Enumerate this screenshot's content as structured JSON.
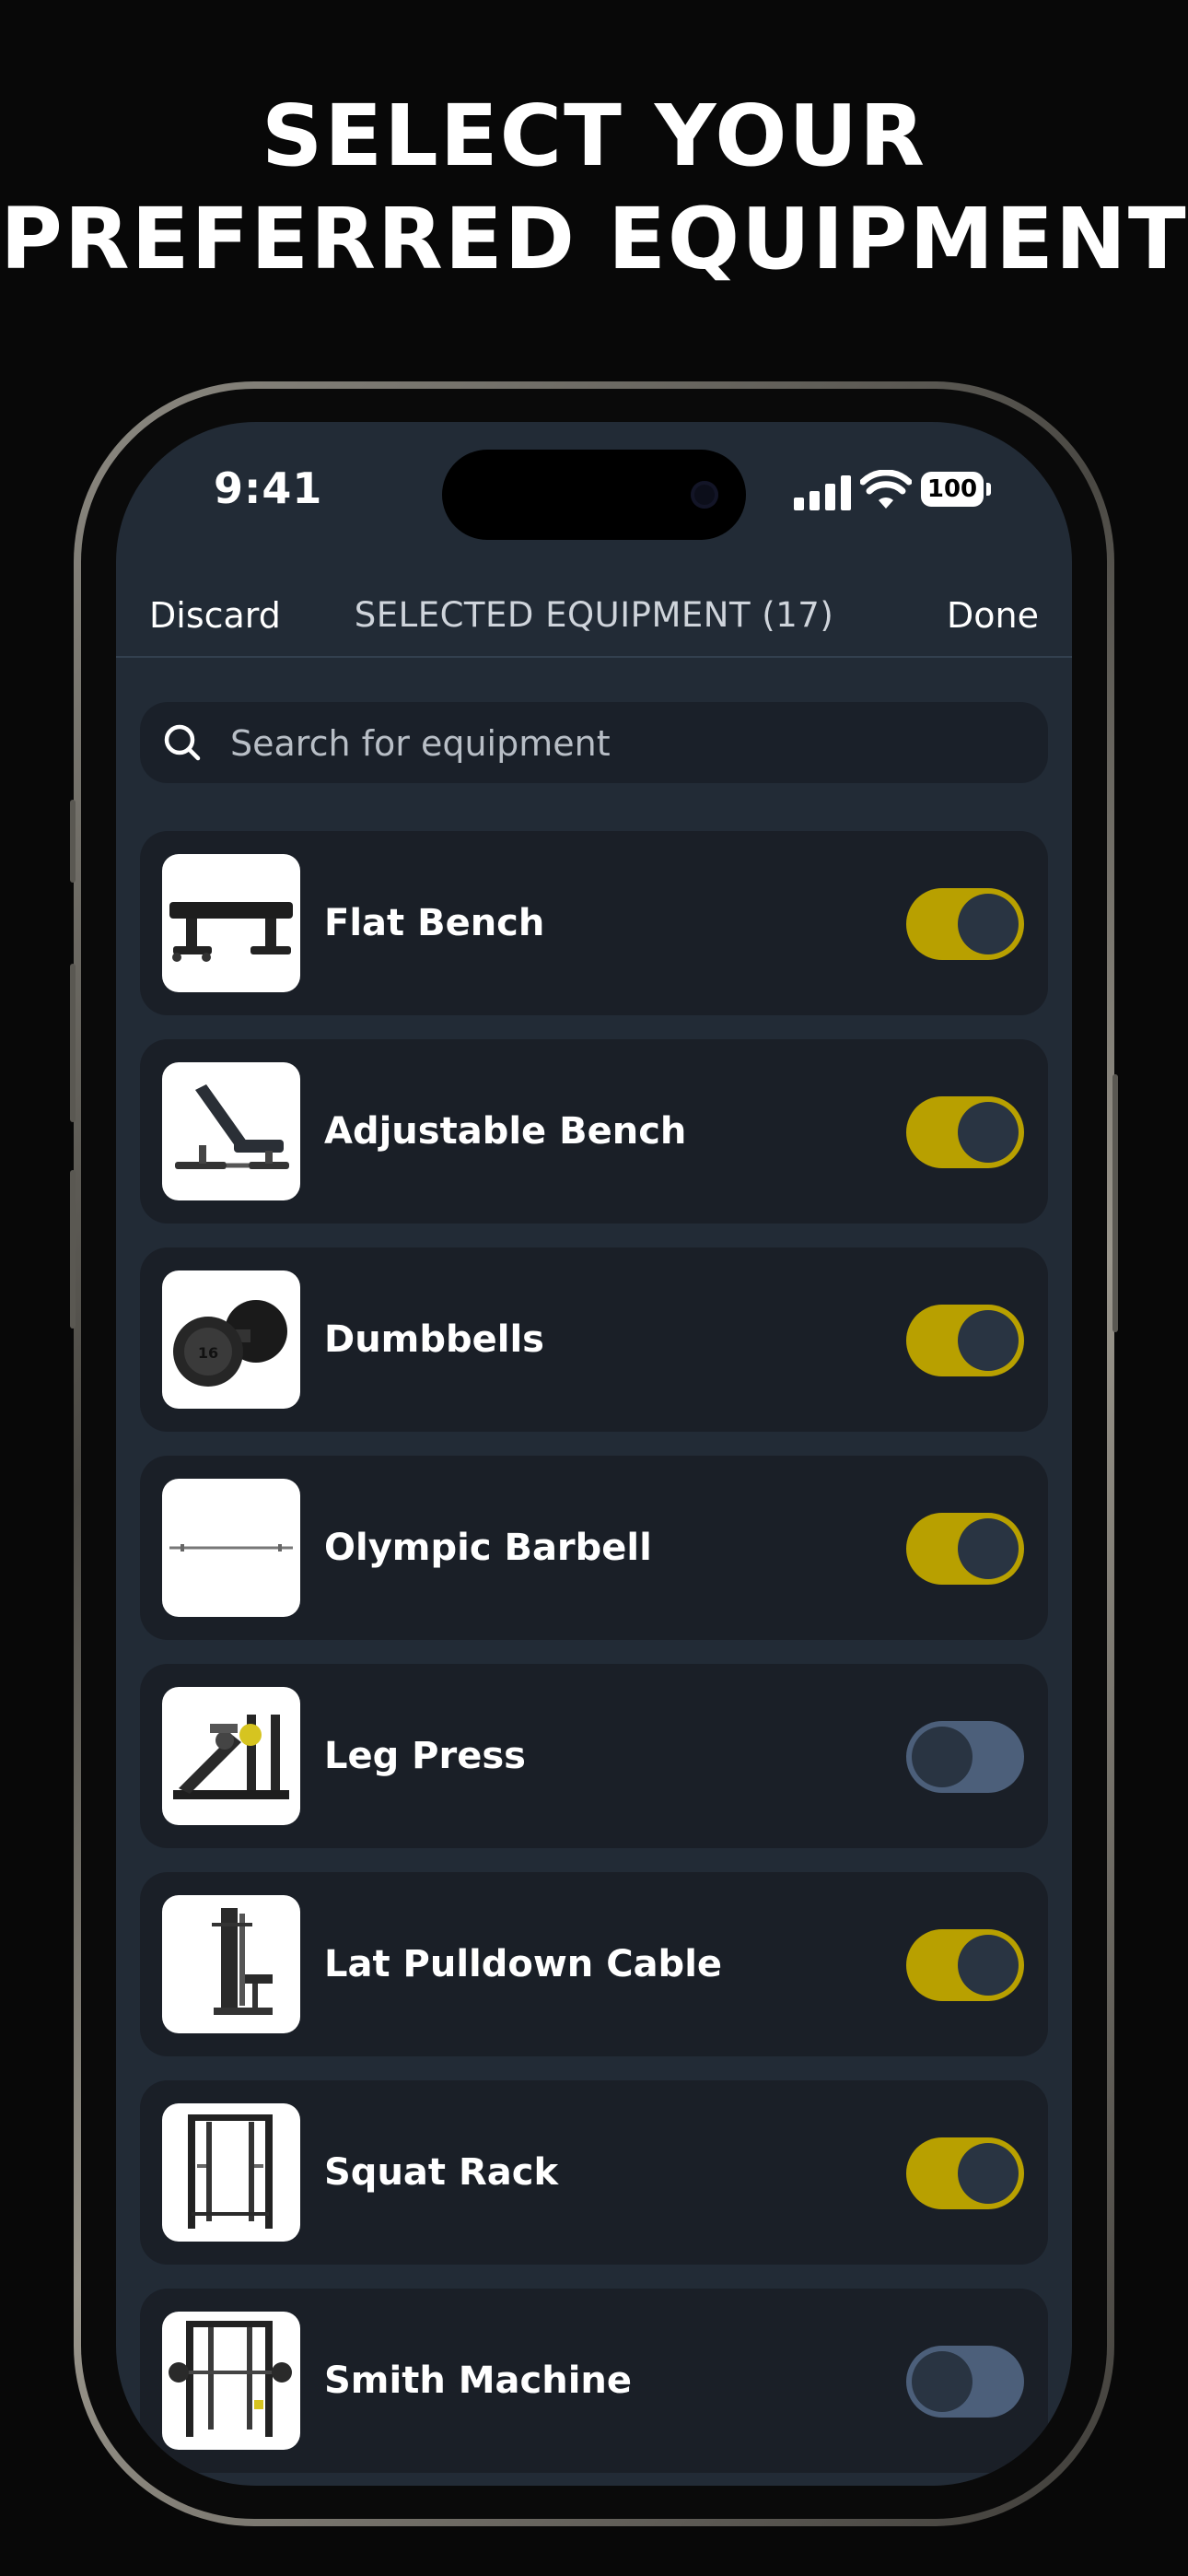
{
  "headline": {
    "line1": "SELECT YOUR",
    "line2": "PREFERRED EQUIPMENT"
  },
  "status_bar": {
    "time": "9:41",
    "battery": "100"
  },
  "nav": {
    "discard_label": "Discard",
    "title": "SELECTED EQUIPMENT (17)",
    "done_label": "Done"
  },
  "search": {
    "placeholder": "Search for equipment",
    "icon": "search-icon"
  },
  "equipment": [
    {
      "label": "Flat Bench",
      "enabled": true,
      "icon": "flat-bench-image"
    },
    {
      "label": "Adjustable Bench",
      "enabled": true,
      "icon": "adjustable-bench-image"
    },
    {
      "label": "Dumbbells",
      "enabled": true,
      "icon": "dumbbell-image",
      "image_text": "16"
    },
    {
      "label": "Olympic Barbell",
      "enabled": true,
      "icon": "barbell-image"
    },
    {
      "label": "Leg Press",
      "enabled": false,
      "icon": "leg-press-image"
    },
    {
      "label": "Lat Pulldown Cable",
      "enabled": true,
      "icon": "lat-pulldown-image"
    },
    {
      "label": "Squat Rack",
      "enabled": true,
      "icon": "squat-rack-image"
    },
    {
      "label": "Smith Machine",
      "enabled": false,
      "icon": "smith-machine-image"
    }
  ],
  "colors": {
    "toggle_on": "#b8a000",
    "toggle_off": "#4c5f7a",
    "screen_bg": "#222b36",
    "row_bg": "#1a1f27"
  }
}
